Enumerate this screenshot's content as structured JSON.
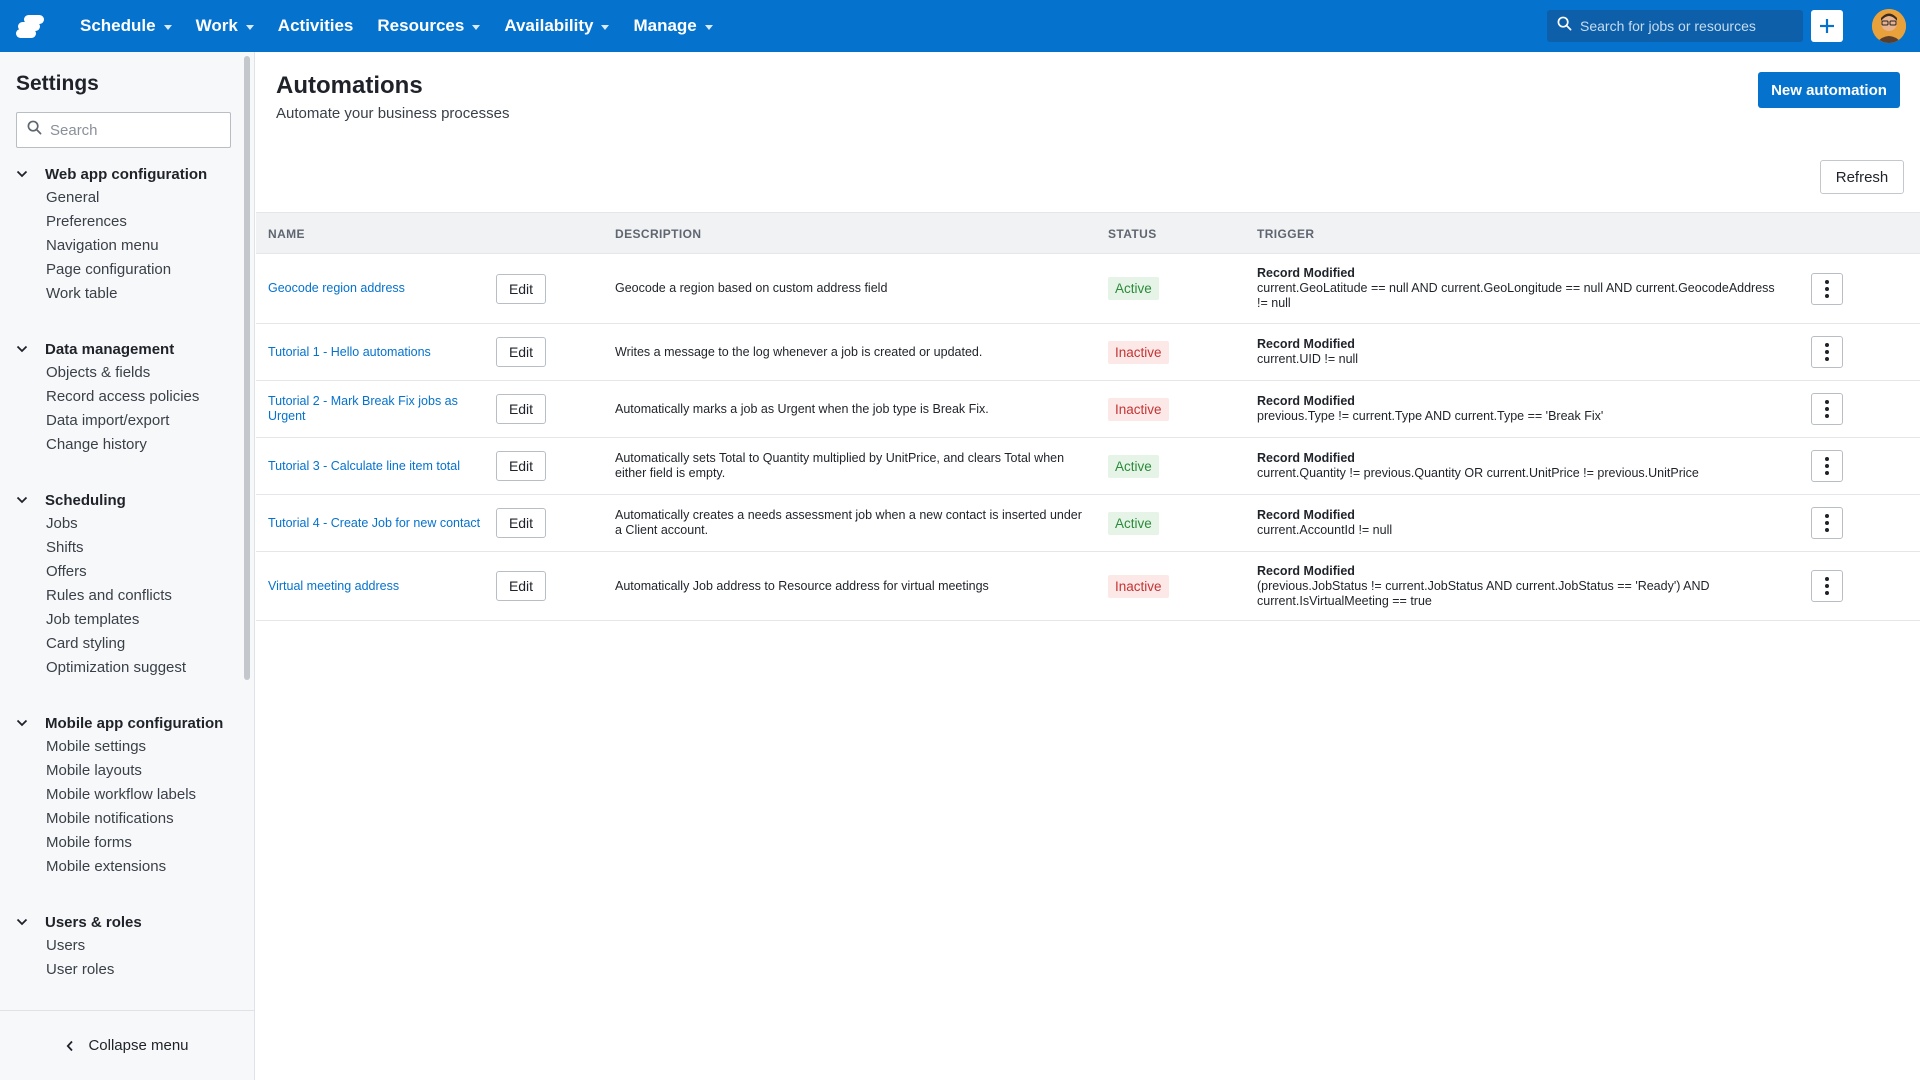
{
  "topbar": {
    "nav": [
      {
        "label": "Schedule",
        "dropdown": true
      },
      {
        "label": "Work",
        "dropdown": true
      },
      {
        "label": "Activities",
        "dropdown": false
      },
      {
        "label": "Resources",
        "dropdown": true
      },
      {
        "label": "Availability",
        "dropdown": true
      },
      {
        "label": "Manage",
        "dropdown": true
      }
    ],
    "search_placeholder": "Search for jobs or resources",
    "brand_color": "#0572ce"
  },
  "sidebar": {
    "title": "Settings",
    "search_placeholder": "Search",
    "groups": [
      {
        "label": "Web app configuration",
        "items": [
          "General",
          "Preferences",
          "Navigation menu",
          "Page configuration",
          "Work table"
        ]
      },
      {
        "label": "Data management",
        "items": [
          "Objects & fields",
          "Record access policies",
          "Data import/export",
          "Change history"
        ]
      },
      {
        "label": "Scheduling",
        "items": [
          "Jobs",
          "Shifts",
          "Offers",
          "Rules and conflicts",
          "Job templates",
          "Card styling",
          "Optimization suggest"
        ]
      },
      {
        "label": "Mobile app configuration",
        "items": [
          "Mobile settings",
          "Mobile layouts",
          "Mobile workflow labels",
          "Mobile notifications",
          "Mobile forms",
          "Mobile extensions"
        ]
      },
      {
        "label": "Users & roles",
        "items": [
          "Users",
          "User roles"
        ]
      }
    ],
    "collapse_label": "Collapse menu"
  },
  "main": {
    "title": "Automations",
    "subtitle": "Automate your business processes",
    "new_button": "New automation",
    "refresh_button": "Refresh",
    "columns": {
      "name": "NAME",
      "description": "DESCRIPTION",
      "status": "STATUS",
      "trigger": "TRIGGER"
    },
    "edit_label": "Edit",
    "rows": [
      {
        "name": "Geocode region address",
        "description": "Geocode a region based on custom address field",
        "status": "Active",
        "trigger_type": "Record Modified",
        "trigger_condition": "current.GeoLatitude == null AND current.GeoLongitude == null AND current.GeocodeAddress != null"
      },
      {
        "name": "Tutorial 1 - Hello automations",
        "description": "Writes a message to the log whenever a job is created or updated.",
        "status": "Inactive",
        "trigger_type": "Record Modified",
        "trigger_condition": "current.UID != null"
      },
      {
        "name": "Tutorial 2 - Mark Break Fix jobs as Urgent",
        "description": "Automatically marks a job as Urgent when the job type is Break Fix.",
        "status": "Inactive",
        "trigger_type": "Record Modified",
        "trigger_condition": "previous.Type != current.Type AND current.Type == 'Break Fix'"
      },
      {
        "name": "Tutorial 3 - Calculate line item total",
        "description": "Automatically sets Total to Quantity multiplied by UnitPrice, and clears Total when either field is empty.",
        "status": "Active",
        "trigger_type": "Record Modified",
        "trigger_condition": "current.Quantity != previous.Quantity OR current.UnitPrice != previous.UnitPrice"
      },
      {
        "name": "Tutorial 4 - Create Job for new contact",
        "description": "Automatically creates a needs assessment job when a new contact is inserted under a Client account.",
        "status": "Active",
        "trigger_type": "Record Modified",
        "trigger_condition": "current.AccountId != null"
      },
      {
        "name": "Virtual meeting address",
        "description": "Automatically Job address to Resource address for virtual meetings",
        "status": "Inactive",
        "trigger_type": "Record Modified",
        "trigger_condition": "(previous.JobStatus != current.JobStatus AND current.JobStatus == 'Ready') AND current.IsVirtualMeeting == true"
      }
    ]
  }
}
